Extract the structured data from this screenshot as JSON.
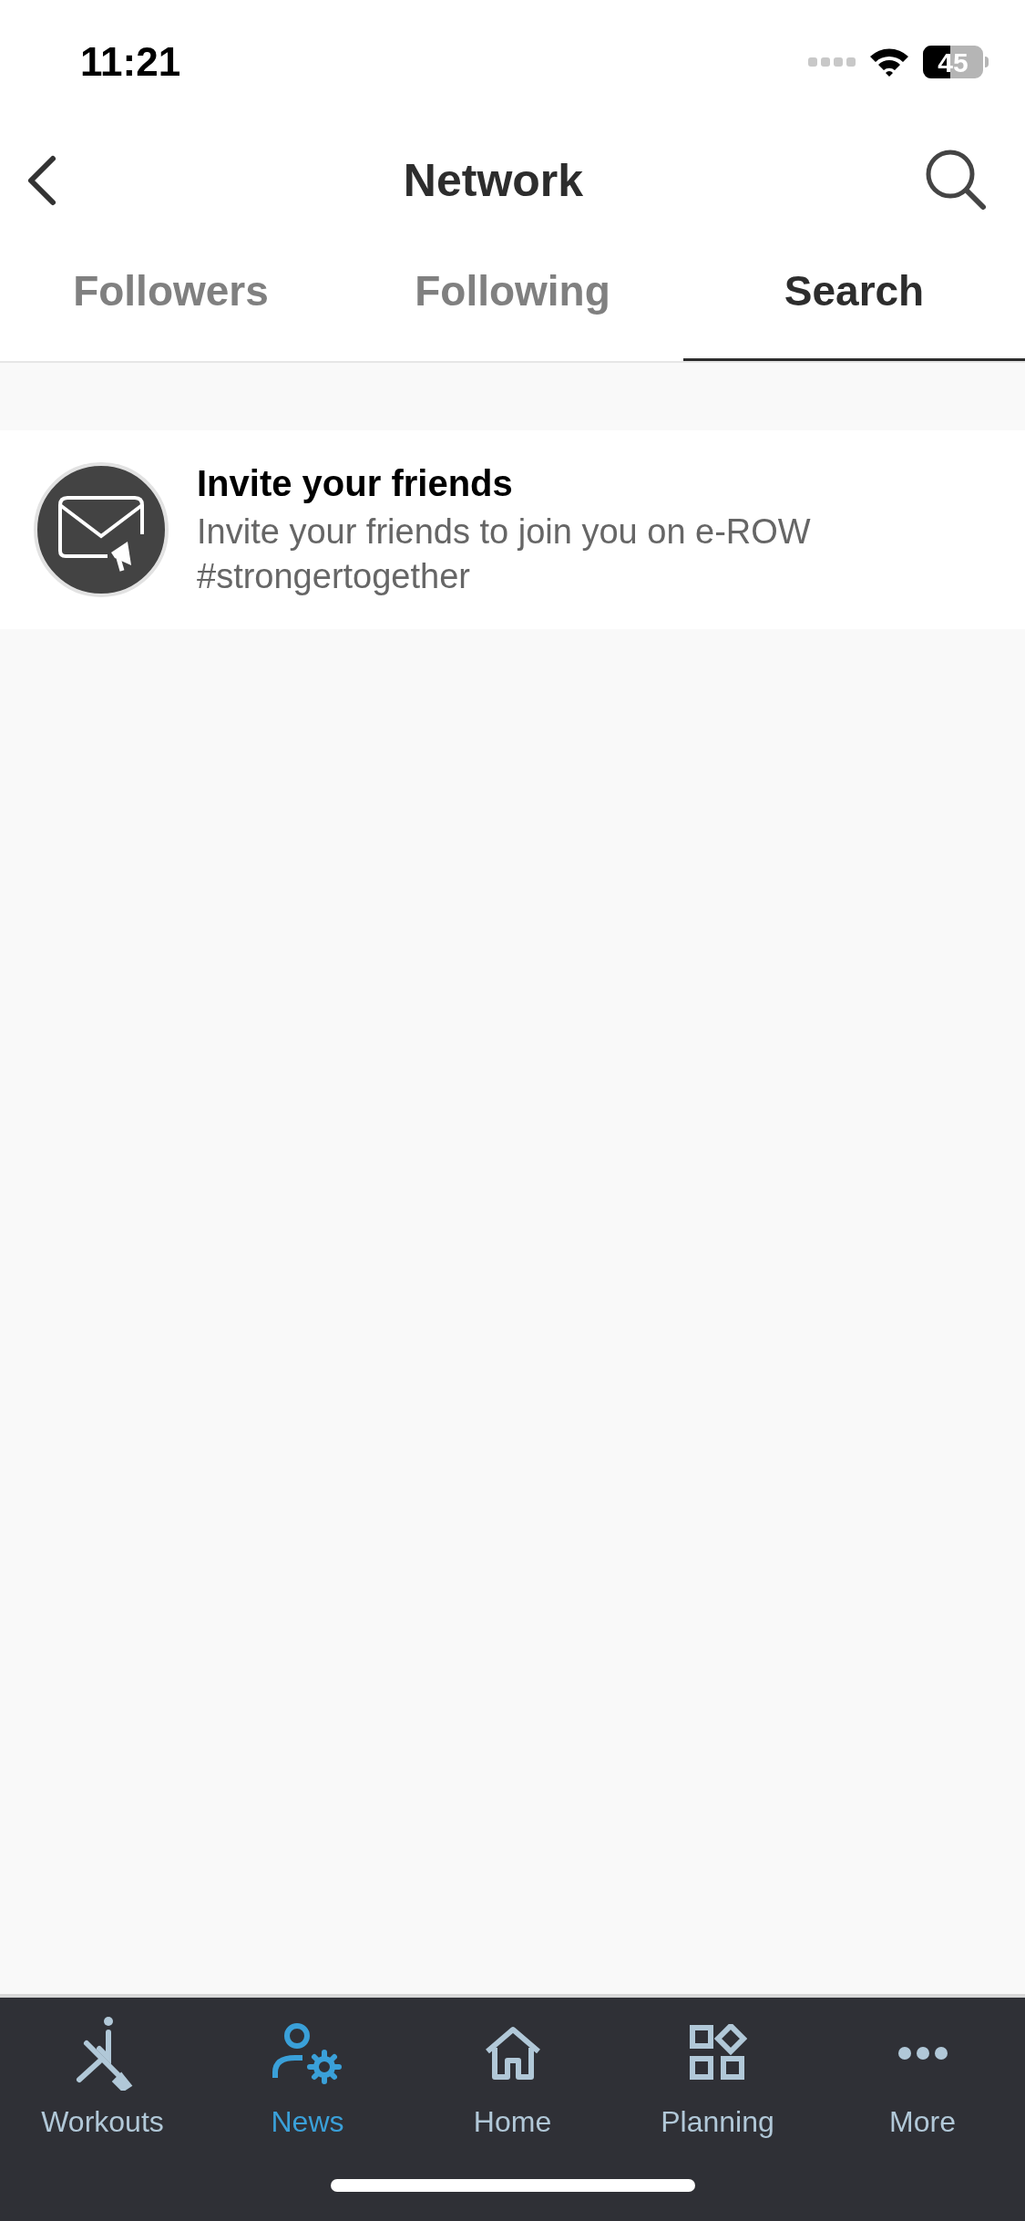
{
  "status_bar": {
    "time": "11:21",
    "battery": "45"
  },
  "header": {
    "title": "Network"
  },
  "tabs": [
    {
      "label": "Followers",
      "selected": false
    },
    {
      "label": "Following",
      "selected": false
    },
    {
      "label": "Search",
      "selected": true
    }
  ],
  "invite": {
    "title": "Invite your friends",
    "subtitle": "Invite your friends to join you on e-ROW #strongertogether"
  },
  "tab_bar": [
    {
      "kind": "workouts",
      "label": "Workouts",
      "selected": false
    },
    {
      "kind": "news",
      "label": "News",
      "selected": true
    },
    {
      "kind": "home",
      "label": "Home",
      "selected": false
    },
    {
      "kind": "planning",
      "label": "Planning",
      "selected": false
    },
    {
      "kind": "more",
      "label": "More",
      "selected": false
    }
  ]
}
